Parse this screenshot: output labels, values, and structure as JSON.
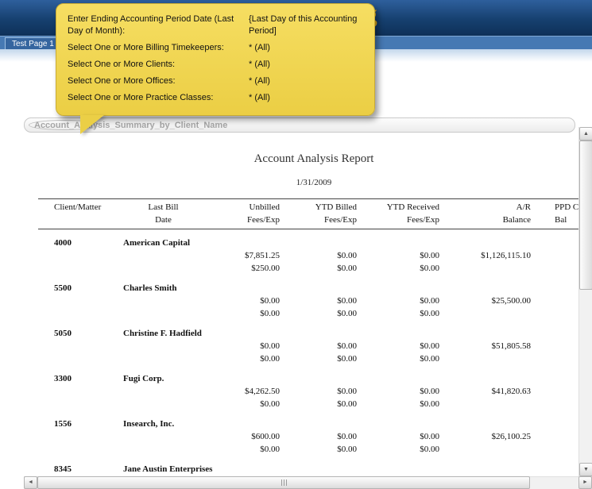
{
  "header": {
    "brand_fragment": "ting",
    "brand_color": "#e8b21e"
  },
  "tabs": {
    "active_label": "Test Page 1"
  },
  "tooltip": {
    "rows": [
      {
        "label": "Enter Ending Accounting Period Date (Last Day of Month):",
        "value": "{Last Day of this Accounting Period]"
      },
      {
        "label": "Select One or More Billing Timekeepers:",
        "value": "* (All)"
      },
      {
        "label": "Select One or More Clients:",
        "value": "* (All)"
      },
      {
        "label": "Select One or More Offices:",
        "value": "* (All)"
      },
      {
        "label": "Select One or More Practice Classes:",
        "value": "* (All)"
      }
    ]
  },
  "section": {
    "title": "Account_Analysis_Summary_by_Client_Name"
  },
  "report": {
    "title": "Account Analysis Report",
    "date": "1/31/2009",
    "columns": [
      {
        "line1": "",
        "line2": "Client/Matter",
        "align": "left"
      },
      {
        "line1": "Last Bill",
        "line2": "Date",
        "align": "center"
      },
      {
        "line1": "Unbilled",
        "line2": "Fees/Exp",
        "align": "right"
      },
      {
        "line1": "YTD Billed",
        "line2": "Fees/Exp",
        "align": "right"
      },
      {
        "line1": "YTD Received",
        "line2": "Fees/Exp",
        "align": "right"
      },
      {
        "line1": "A/R",
        "line2": "Balance",
        "align": "right"
      },
      {
        "line1": "PPD C",
        "line2": "Bal",
        "align": "left"
      }
    ],
    "groups": [
      {
        "client_id": "4000",
        "client_name": "American Capital",
        "rows": [
          [
            "$7,851.25",
            "$0.00",
            "$0.00",
            "$1,126,115.10",
            ""
          ],
          [
            "$250.00",
            "$0.00",
            "$0.00",
            "",
            ""
          ]
        ]
      },
      {
        "client_id": "5500",
        "client_name": "Charles Smith",
        "rows": [
          [
            "$0.00",
            "$0.00",
            "$0.00",
            "$25,500.00",
            ""
          ],
          [
            "$0.00",
            "$0.00",
            "$0.00",
            "",
            ""
          ]
        ]
      },
      {
        "client_id": "5050",
        "client_name": "Christine F. Hadfield",
        "rows": [
          [
            "$0.00",
            "$0.00",
            "$0.00",
            "$51,805.58",
            ""
          ],
          [
            "$0.00",
            "$0.00",
            "$0.00",
            "",
            ""
          ]
        ]
      },
      {
        "client_id": "3300",
        "client_name": "Fugi Corp.",
        "rows": [
          [
            "$4,262.50",
            "$0.00",
            "$0.00",
            "$41,820.63",
            ""
          ],
          [
            "$0.00",
            "$0.00",
            "$0.00",
            "",
            ""
          ]
        ]
      },
      {
        "client_id": "1556",
        "client_name": "Insearch, Inc.",
        "rows": [
          [
            "$600.00",
            "$0.00",
            "$0.00",
            "$26,100.25",
            ""
          ],
          [
            "$0.00",
            "$0.00",
            "$0.00",
            "",
            ""
          ]
        ]
      },
      {
        "client_id": "8345",
        "client_name": "Jane Austin Enterprises",
        "rows": []
      }
    ]
  },
  "scroll": {
    "up_glyph": "▲",
    "down_glyph": "▼",
    "left_glyph": "◄",
    "right_glyph": "►"
  }
}
